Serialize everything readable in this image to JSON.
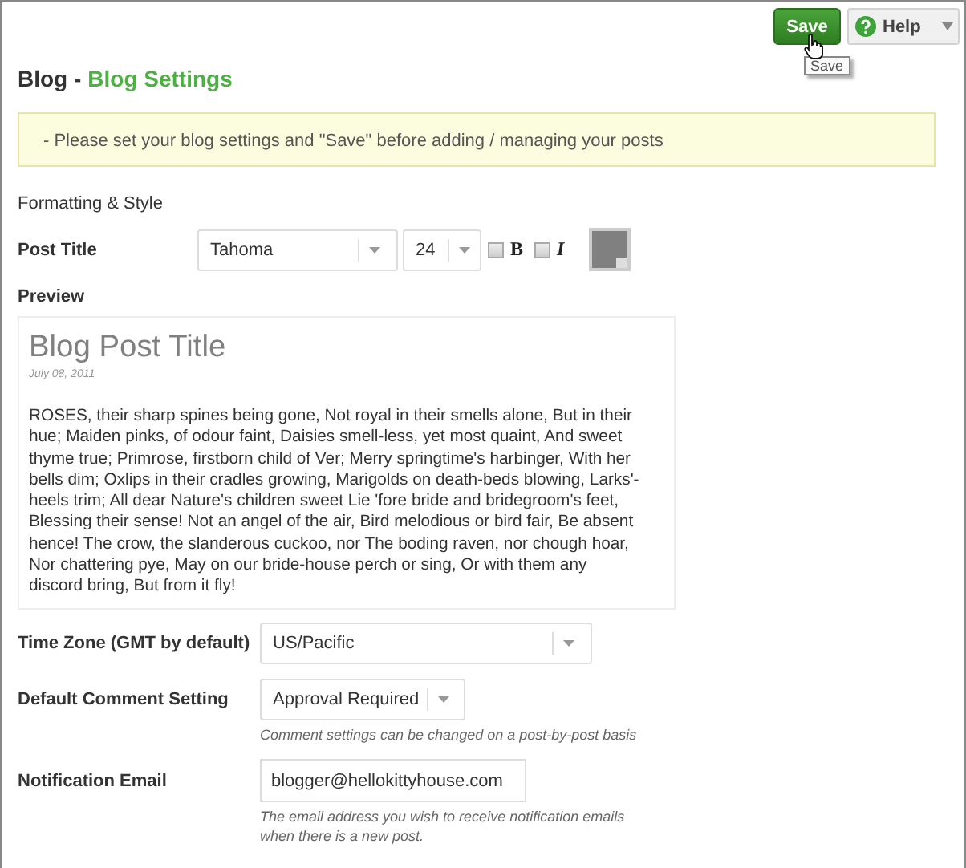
{
  "toolbar": {
    "save_button": "Save",
    "help_button": "Help",
    "tooltip": "Save"
  },
  "heading": {
    "section": "Blog -",
    "page": "Blog Settings"
  },
  "notice": "- Please set your blog settings and \"Save\" before adding / managing your posts",
  "section_label": "Formatting & Style",
  "post_title": {
    "label": "Post Title",
    "font": "Tahoma",
    "size": "24",
    "bold": {
      "label": "B",
      "checked": false
    },
    "italic": {
      "label": "I",
      "checked": false
    },
    "color": "#808080"
  },
  "preview": {
    "label": "Preview",
    "title": "Blog Post Title",
    "date": "July 08, 2011",
    "body": "ROSES, their sharp spines being gone, Not royal in their smells alone, But in their hue; Maiden pinks, of odour faint, Daisies smell-less, yet most quaint, And sweet thyme true; Primrose, firstborn child of Ver; Merry springtime's harbinger, With her bells dim; Oxlips in their cradles growing, Marigolds on death-beds blowing, Larks'-heels trim; All dear Nature's children sweet Lie 'fore bride and bridegroom's feet, Blessing their sense! Not an angel of the air, Bird melodious or bird fair, Be absent hence! The crow, the slanderous cuckoo, nor The boding raven, nor chough hoar, Nor chattering pye, May on our bride-house perch or sing, Or with them any discord bring, But from it fly!"
  },
  "fields": [
    {
      "kind": "select",
      "label": "Time Zone (GMT by default)",
      "value": "US/Pacific"
    },
    {
      "kind": "select",
      "label": "Default Comment Setting",
      "value": "Approval Required",
      "hint": "Comment settings can be changed on a post-by-post basis"
    },
    {
      "kind": "input",
      "label": "Notification Email",
      "value": "blogger@hellokittyhouse.com",
      "hint": "The email address you wish to receive notification emails when there is a new post."
    }
  ]
}
